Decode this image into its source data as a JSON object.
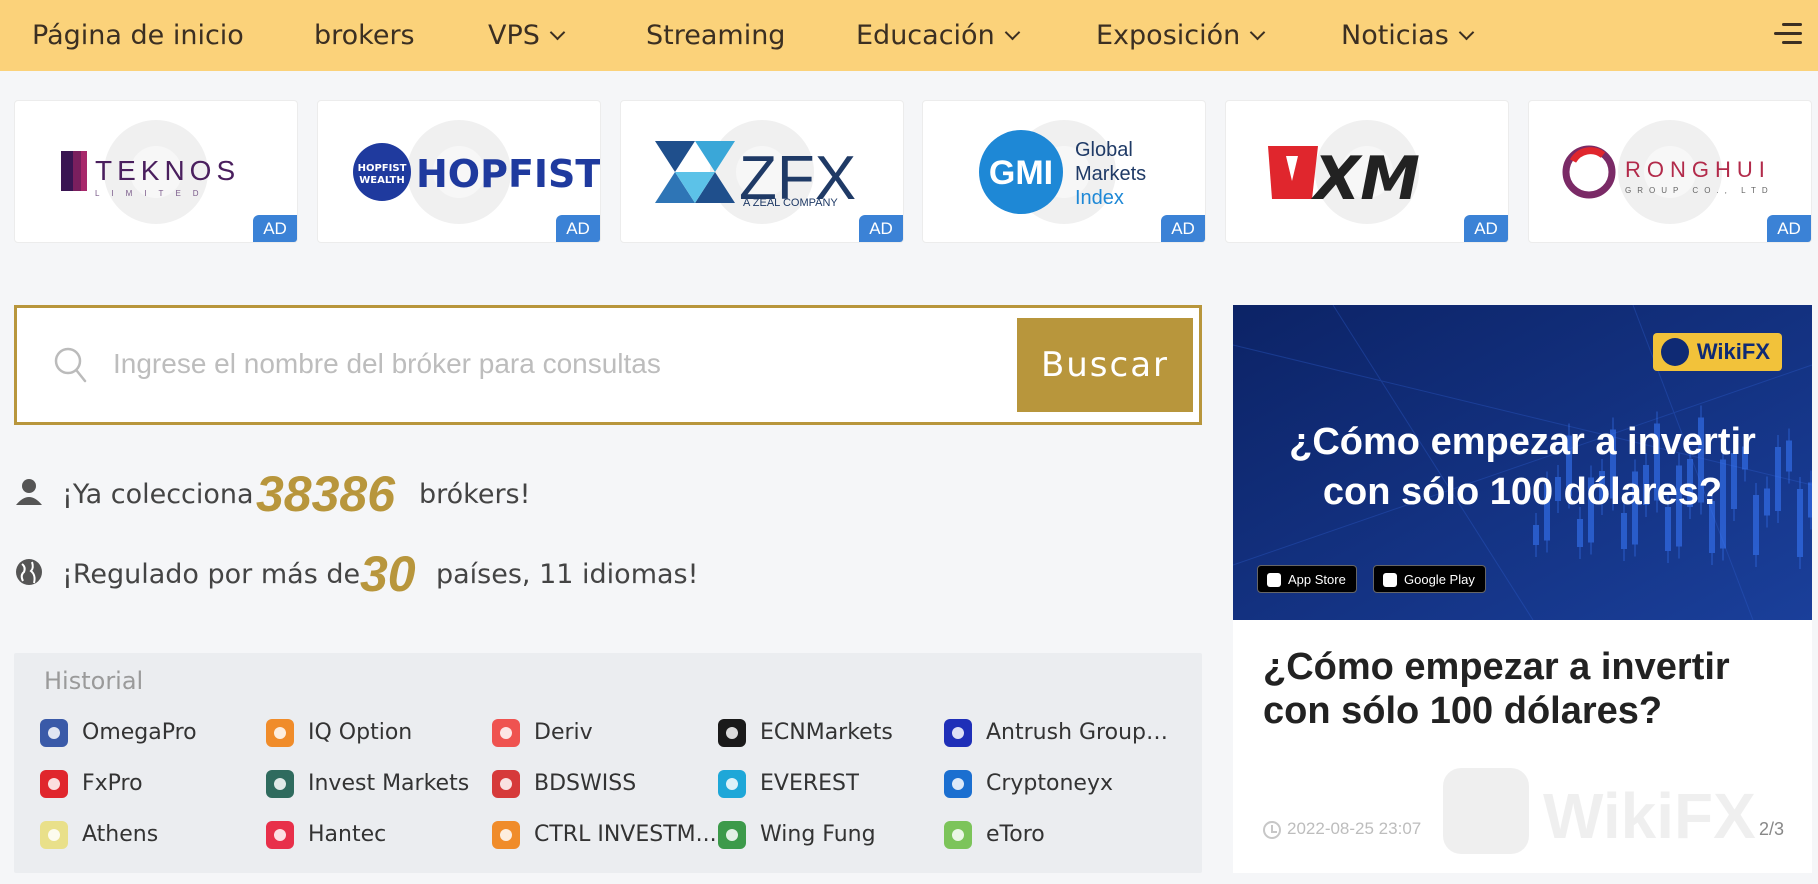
{
  "nav": {
    "items": [
      {
        "label": "Página de inicio",
        "dropdown": false
      },
      {
        "label": "brokers",
        "dropdown": false
      },
      {
        "label": "VPS",
        "dropdown": true
      },
      {
        "label": "Streaming",
        "dropdown": false
      },
      {
        "label": "Educación",
        "dropdown": true
      },
      {
        "label": "Exposición",
        "dropdown": true
      },
      {
        "label": "Noticias",
        "dropdown": true
      }
    ],
    "menu_icon": "hamburger-menu-icon",
    "background": "#fbd27a"
  },
  "ads": {
    "badge_label": "AD",
    "badge_color": "#3b82d6",
    "items": [
      {
        "name": "TEKNOS",
        "sub": "LIMITED"
      },
      {
        "name": "HOPFIST",
        "sub": "HOPFIST WEALTH"
      },
      {
        "name": "ZFX",
        "sub": "A ZEAL COMPANY"
      },
      {
        "name": "GMI",
        "sub": "Global Markets Index"
      },
      {
        "name": "XM",
        "sub": ""
      },
      {
        "name": "RONGHUI",
        "sub": "GROUP CO., LTD"
      }
    ]
  },
  "search": {
    "placeholder": "Ingrese el nombre del bróker para consultas",
    "value": "",
    "button_label": "Buscar",
    "accent": "#b8963c"
  },
  "stats": {
    "collect_prefix": "¡Ya colecciona",
    "collect_count": "38386",
    "collect_suffix": "brókers!",
    "regulated_prefix": "¡Regulado por más de",
    "regulated_count": "30",
    "regulated_suffix": "países, 11 idiomas!"
  },
  "history": {
    "title": "Historial",
    "items": [
      {
        "label": "OmegaPro",
        "color": "#3a5aa8"
      },
      {
        "label": "IQ Option",
        "color": "#f08c2a"
      },
      {
        "label": "Deriv",
        "color": "#ef5350"
      },
      {
        "label": "ECNMarkets",
        "color": "#1a1a1a"
      },
      {
        "label": "Antrush Group ...",
        "color": "#1f2fb8"
      },
      {
        "label": "FxPro",
        "color": "#e0262d"
      },
      {
        "label": "Invest Markets",
        "color": "#2f6b5e"
      },
      {
        "label": "BDSWISS",
        "color": "#d63a3a"
      },
      {
        "label": "EVEREST",
        "color": "#1ea7d8"
      },
      {
        "label": "Cryptoneyx",
        "color": "#1b6fd0"
      },
      {
        "label": "Athens",
        "color": "#e9e08a"
      },
      {
        "label": "Hantec",
        "color": "#e8304a"
      },
      {
        "label": "CTRL INVESTM...",
        "color": "#f08c2a"
      },
      {
        "label": "Wing Fung",
        "color": "#3c9a4a"
      },
      {
        "label": "eToro",
        "color": "#7cc45a"
      }
    ]
  },
  "news": {
    "badge": "WikiFX",
    "banner_title_line1": "¿Cómo empezar a invertir",
    "banner_title_line2": "con sólo 100 dólares?",
    "app_store": "App Store",
    "google_play": "Google Play",
    "title": "¿Cómo empezar a invertir con sólo 100 dólares?",
    "timestamp": "2022-08-25 23:07",
    "pager": "2/3",
    "watermark": "WikiFX"
  }
}
